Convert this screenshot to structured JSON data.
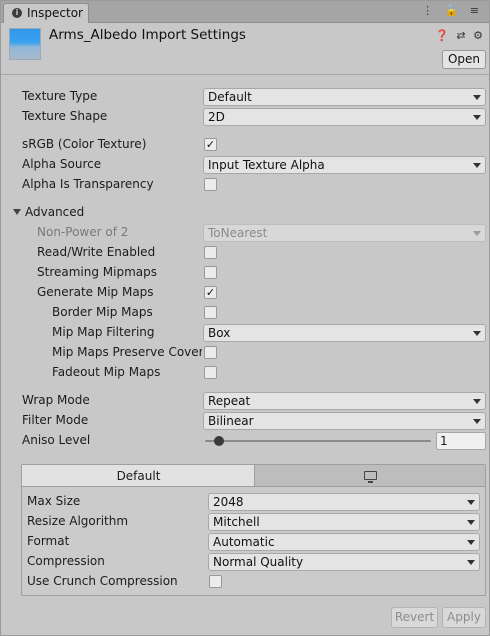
{
  "window": {
    "tab_title": "Inspector",
    "tab_actions": "⋮ 🔒 ≡"
  },
  "header": {
    "title": "Arms_Albedo Import Settings",
    "open_label": "Open",
    "icons": [
      "help-icon",
      "presets-icon",
      "settings-icon"
    ]
  },
  "fields": {
    "texture_type": {
      "label": "Texture Type",
      "value": "Default"
    },
    "texture_shape": {
      "label": "Texture Shape",
      "value": "2D"
    },
    "srgb": {
      "label": "sRGB (Color Texture)",
      "checked": true
    },
    "alpha_source": {
      "label": "Alpha Source",
      "value": "Input Texture Alpha"
    },
    "alpha_transparency": {
      "label": "Alpha Is Transparency",
      "checked": false
    },
    "advanced": {
      "label": "Advanced",
      "expanded": true
    },
    "npot": {
      "label": "Non-Power of 2",
      "value": "ToNearest"
    },
    "read_write": {
      "label": "Read/Write Enabled",
      "checked": false
    },
    "streaming": {
      "label": "Streaming Mipmaps",
      "checked": false
    },
    "gen_mips": {
      "label": "Generate Mip Maps",
      "checked": true
    },
    "border_mips": {
      "label": "Border Mip Maps",
      "checked": false
    },
    "mip_filter": {
      "label": "Mip Map Filtering",
      "value": "Box"
    },
    "preserve_coverage": {
      "label": "Mip Maps Preserve Coverage",
      "checked": false
    },
    "fadeout": {
      "label": "Fadeout Mip Maps",
      "checked": false
    },
    "wrap_mode": {
      "label": "Wrap Mode",
      "value": "Repeat"
    },
    "filter_mode": {
      "label": "Filter Mode",
      "value": "Bilinear"
    },
    "aniso": {
      "label": "Aniso Level",
      "value": "1",
      "level": 0.0625
    }
  },
  "platform": {
    "default_tab": "Default",
    "standalone_icon": "monitor-icon",
    "max_size": {
      "label": "Max Size",
      "value": "2048"
    },
    "resize": {
      "label": "Resize Algorithm",
      "value": "Mitchell"
    },
    "format": {
      "label": "Format",
      "value": "Automatic"
    },
    "compression": {
      "label": "Compression",
      "value": "Normal Quality"
    },
    "crunch": {
      "label": "Use Crunch Compression",
      "checked": false
    }
  },
  "footer": {
    "revert_label": "Revert",
    "apply_label": "Apply"
  },
  "colors": {
    "panel": "#c8c8c8",
    "accent_thumbnail": "#2f97e8"
  }
}
